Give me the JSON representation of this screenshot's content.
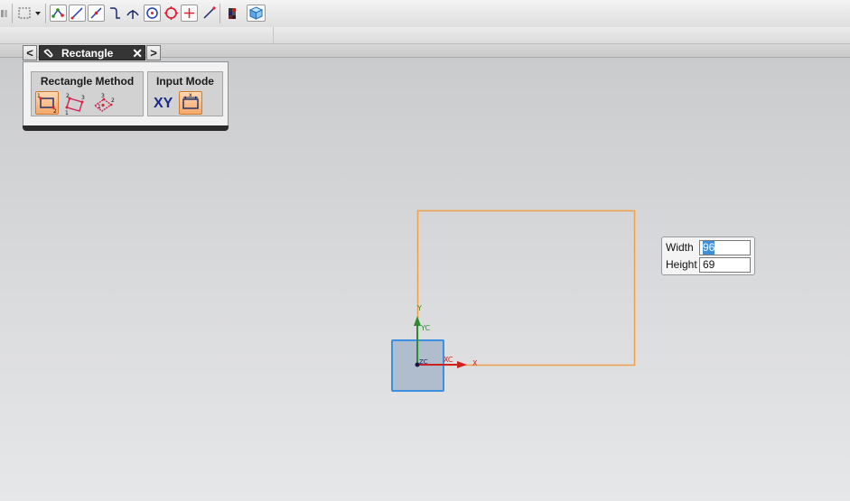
{
  "toolbar": {
    "icons": [
      "select-filter-icon",
      "dropdown-arrow-icon",
      "profile-icon",
      "line-icon",
      "arc-icon",
      "fillet-icon",
      "chamfer-icon",
      "circle-icon",
      "circle-point-icon",
      "point-icon",
      "trim-icon",
      "extend-icon",
      "color-palette-icon",
      "cube-view-icon"
    ]
  },
  "dialog": {
    "title": "Rectangle",
    "back_glyph": "<",
    "forward_glyph": ">",
    "close_glyph": "✕",
    "groups": {
      "method_label": "Rectangle Method",
      "input_label": "Input Mode",
      "xy_label": "XY"
    }
  },
  "dimensions": {
    "width_label": "Width",
    "width_value": "96",
    "height_label": "Height",
    "height_value": "69"
  },
  "canvas": {
    "axis_y_label": "Y",
    "axis_yc_label": "YC",
    "axis_xc_label": "XC",
    "axis_x_label": "X",
    "axis_zc_label": "ZC",
    "sketch_color": "#f0a04b",
    "y_axis_color": "#2e8b2e",
    "x_axis_color": "#cc2222",
    "plane_color": "#3d8fe0"
  }
}
